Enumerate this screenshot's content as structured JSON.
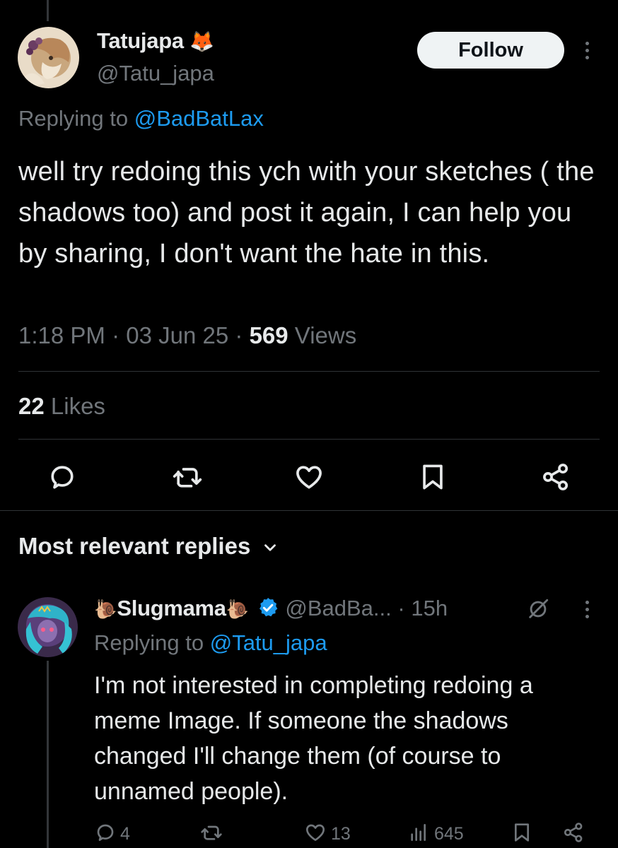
{
  "tweet": {
    "author_name": "Tatujapa",
    "author_emoji": "🦊",
    "author_handle": "@Tatu_japa",
    "follow_label": "Follow",
    "replying_prefix": "Replying to ",
    "replying_handle": "@BadBatLax",
    "text": "well try redoing this ych with your sketches ( the shadows too) and post it again, I can help you by sharing, I don't want the hate in this.",
    "time": "1:18 PM",
    "date": "03 Jun 25",
    "views_count": "569",
    "views_label": "Views",
    "likes_count": "22",
    "likes_label": "Likes"
  },
  "replies_section": {
    "title": "Most relevant replies"
  },
  "reply": {
    "name": "Slugmama",
    "name_emoji_left": "🐌",
    "name_emoji_right": "🐌",
    "handle": "@BadBa...",
    "separator": "·",
    "time": "15h",
    "replying_prefix": "Replying to ",
    "replying_handle": "@Tatu_japa",
    "text": "I'm not interested in completing redoing a meme Image. If someone the shadows changed I'll change them (of course to unnamed people).",
    "reply_count": "4",
    "like_count": "13",
    "view_count": "645"
  },
  "colors": {
    "background": "#000000",
    "text_primary": "#e7e9ea",
    "text_secondary": "#71767b",
    "link": "#1d9bf0",
    "verified": "#1d9bf0",
    "divider": "#2f3336"
  },
  "icons": {
    "reply": "reply-icon",
    "retweet": "retweet-icon",
    "like": "heart-icon",
    "bookmark": "bookmark-icon",
    "share": "share-icon",
    "views": "views-icon",
    "verified": "verified-badge-icon",
    "grok": "grok-icon",
    "chevron": "chevron-down-icon",
    "more": "more-dots-icon"
  }
}
